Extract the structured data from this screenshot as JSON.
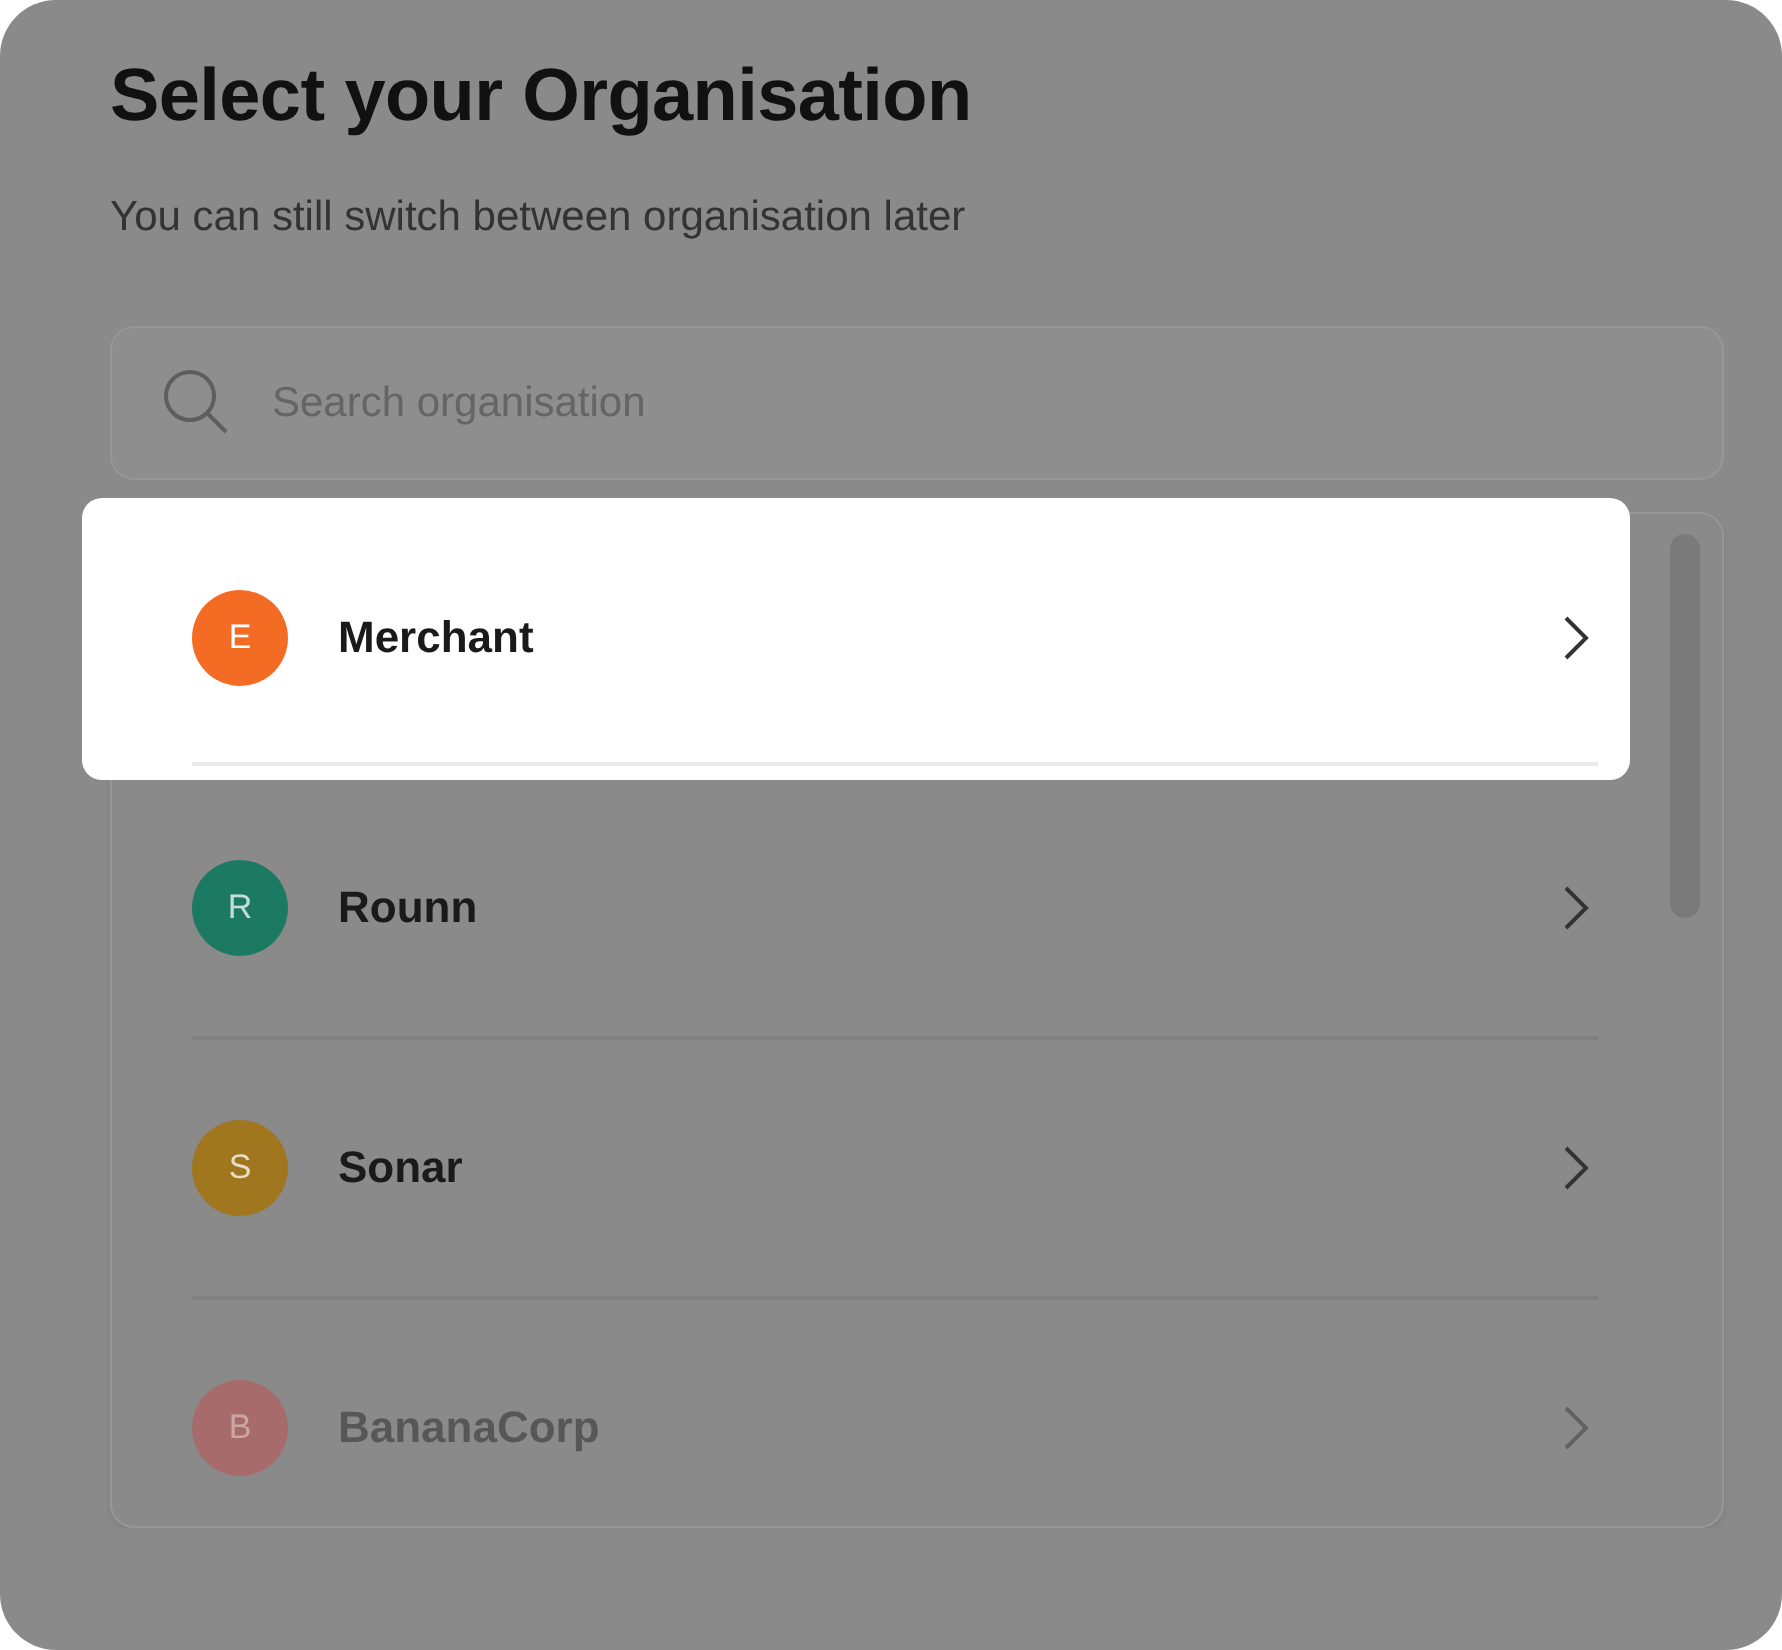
{
  "dialog": {
    "title": "Select your Organisation",
    "subtitle": "You can still switch between organisation later"
  },
  "search": {
    "placeholder": "Search organisation"
  },
  "organisations": [
    {
      "initial": "E",
      "name": "Merchant",
      "color": "#f46b23",
      "highlighted": true,
      "faded": false
    },
    {
      "initial": "R",
      "name": "Rounn",
      "color": "#1c7a62",
      "highlighted": false,
      "faded": false
    },
    {
      "initial": "S",
      "name": "Sonar",
      "color": "#a0761e",
      "highlighted": false,
      "faded": false
    },
    {
      "initial": "B",
      "name": "BananaCorp",
      "color": "#a86b6b",
      "highlighted": false,
      "faded": true
    }
  ]
}
